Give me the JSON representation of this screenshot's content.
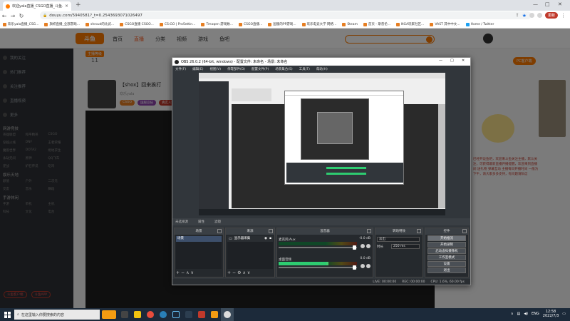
{
  "browser": {
    "tab_title": "欢迎yala直播_CSGO直播_斗鱼...",
    "url": "douyu.com/5940581?_t=0.2543693071026497",
    "restore_label": "更新",
    "bookmarks": [
      "欢乐yala直播_CSG...",
      "旗帜直播_全部游戏...",
      "shroud的比武...",
      "CSGO直播 CSGO...",
      "CS:GO | ProSettin...",
      "Tmoqen 游戏数...",
      "CSGO直播...",
      "国服的PP游戏...",
      "欢乐电竞大学 网络...",
      "Steam",
      "首页 - 斯普伦...",
      "NGA玩家社区...",
      "VAST 其中中文...",
      "Home / Twitter"
    ]
  },
  "douyu": {
    "logo": "斗鱼",
    "nav": [
      "首页",
      "直播",
      "分类",
      "视频",
      "游戏",
      "鱼吧"
    ],
    "sidebar": {
      "items": [
        "我的关注",
        "热门推荐",
        "关注推荐",
        "直播视频",
        "更多"
      ],
      "section1": "网游竞技",
      "grid1": [
        "英雄联盟",
        "和平精英",
        "CSGO",
        "穿越火线",
        "DNF",
        "王者荣耀",
        "魔兽世界",
        "DOTA2",
        "绝地求生",
        "永劫无间",
        "原神",
        "QQ飞车",
        "逆战",
        "炉石传说",
        "吃鸡"
      ],
      "section2": "娱乐天地",
      "grid2": [
        "颜值",
        "户外",
        "二次元",
        "交友",
        "音乐",
        "舞蹈"
      ],
      "section3": "手游休闲",
      "grid3": [
        "手游",
        "单机",
        "主机",
        "科技",
        "文化",
        "电台"
      ],
      "footer": [
        "斗鱼客户端",
        "斗鱼APP"
      ]
    },
    "room": {
      "level_badge": "主播等级",
      "level_num": "11",
      "title": "【shox】回来挨打",
      "sub": "欢乐yala",
      "tags": [
        "CSGO",
        "国服竞技",
        "真实人气"
      ]
    },
    "pc_btn": "PC客户端",
    "right_text": "已经开设鱼吧，欢迎来斗鱼关注主播，默认关注，可获得最新直播开播提醒，欢迎来到直播间 送礼物 弹幕互动 主播每日开播时间 一般为下午，请大家多多支持，有问题请私信"
  },
  "obs": {
    "title": "OBS 26.0.2 (64-bit, windows) - 配置文件: 未命名 - 场景: 未命名",
    "menu": [
      "文件(F)",
      "编辑(E)",
      "视图(V)",
      "停靠部件(D)",
      "配置文件(P)",
      "场景集合(S)",
      "工具(T)",
      "帮助(H)"
    ],
    "divider": [
      "未选择源",
      "属性",
      "滤镜"
    ],
    "docks": {
      "scenes": "场景",
      "sources": "来源",
      "mixer": "混音器",
      "transitions": "转场特效",
      "controls": "控件"
    },
    "scene_item": "场景",
    "source_item": "显示器采集",
    "mixer": [
      {
        "name": "麦克风/Aux",
        "db": "-0.0 dB"
      },
      {
        "name": "桌面音频",
        "db": "0.0 dB"
      }
    ],
    "transition": "淡出",
    "duration_label": "时长",
    "duration_value": "250 ms",
    "controls": [
      "开始推流",
      "开始录制",
      "启动虚拟摄像机",
      "工作室模式",
      "设置",
      "退出"
    ],
    "status": [
      "LIVE: 00:00:00",
      "REC: 00:00:00",
      "CPU: 1.6%, 60.00 fps"
    ]
  },
  "taskbar": {
    "search_placeholder": "在这里输入你要搜索的内容",
    "lang": "ENG",
    "time": "12:58",
    "date": "2022/7/3"
  }
}
